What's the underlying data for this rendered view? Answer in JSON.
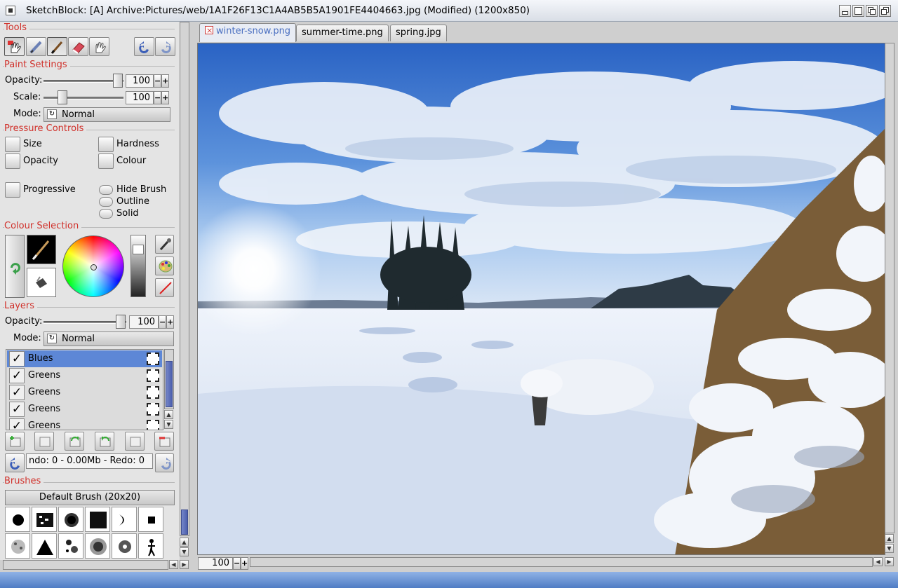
{
  "window": {
    "title": "SketchBlock:  [A] Archive:Pictures/web/1A1F26F13C1A4AB5B5A1901FE4404663.jpg (Modified)  (1200x850)"
  },
  "tools": {
    "section_title": "Tools",
    "buttons": [
      "paint-hand",
      "airbrush",
      "paintbrush",
      "eraser",
      "move-hand"
    ],
    "undo": "undo",
    "redo": "redo"
  },
  "paint_settings": {
    "section_title": "Paint Settings",
    "opacity_label": "Opacity:",
    "opacity_value": "100",
    "opacity_level": 1.0,
    "scale_label": "Scale:",
    "scale_value": "100",
    "scale_level": 0.25,
    "mode_label": "Mode:",
    "mode_value": "Normal"
  },
  "pressure_controls": {
    "section_title": "Pressure Controls",
    "size": "Size",
    "hardness": "Hardness",
    "opacity": "Opacity",
    "colour": "Colour",
    "progressive": "Progressive",
    "hide_brush": "Hide Brush",
    "outline": "Outline",
    "solid": "Solid"
  },
  "colour_selection": {
    "section_title": "Colour Selection"
  },
  "layers": {
    "section_title": "Layers",
    "opacity_label": "Opacity:",
    "opacity_value": "100",
    "mode_label": "Mode:",
    "mode_value": "Normal",
    "items": [
      {
        "name": "Blues",
        "checked": "✓",
        "selected": true
      },
      {
        "name": "Greens",
        "checked": "✓",
        "selected": false
      },
      {
        "name": "Greens",
        "checked": "✓",
        "selected": false
      },
      {
        "name": "Greens",
        "checked": "✓",
        "selected": false
      },
      {
        "name": "Greens",
        "checked": "✓",
        "selected": false
      }
    ],
    "undo_status": "ndo: 0 - 0.00Mb - Redo: 0"
  },
  "brushes": {
    "section_title": "Brushes",
    "current": "Default Brush (20x20)"
  },
  "tabs": [
    {
      "label": "winter-snow.png",
      "active": true
    },
    {
      "label": "summer-time.png",
      "active": false
    },
    {
      "label": "spring.jpg",
      "active": false
    }
  ],
  "zoom": {
    "value": "100"
  },
  "colors": {
    "accent": "#5d87d6",
    "section_title": "#d0302a",
    "statusbar": "#5a86cc"
  }
}
